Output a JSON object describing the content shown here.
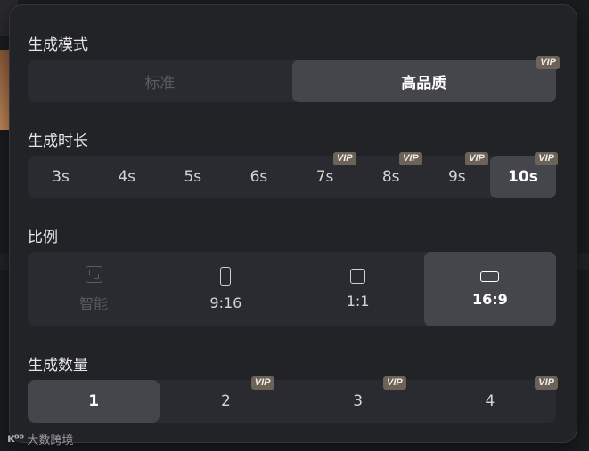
{
  "watermark": {
    "logo": "ᴋᵒᵒ",
    "text": "大数跨境"
  },
  "mode": {
    "title": "生成模式",
    "options": [
      {
        "label": "标准",
        "state": "disabled",
        "vip": ""
      },
      {
        "label": "高品质",
        "state": "active",
        "vip": "VIP"
      }
    ]
  },
  "duration": {
    "title": "生成时长",
    "options": [
      {
        "label": "3s",
        "vip": ""
      },
      {
        "label": "4s",
        "vip": ""
      },
      {
        "label": "5s",
        "vip": ""
      },
      {
        "label": "6s",
        "vip": ""
      },
      {
        "label": "7s",
        "vip": "VIP"
      },
      {
        "label": "8s",
        "vip": "VIP"
      },
      {
        "label": "9s",
        "vip": "VIP"
      },
      {
        "label": "10s",
        "vip": "VIP",
        "active": true
      }
    ]
  },
  "ratio": {
    "title": "比例",
    "options": [
      {
        "label": "智能",
        "icon": "smart-ratio-icon",
        "state": "disabled"
      },
      {
        "label": "9:16",
        "icon": "portrait-ratio-icon",
        "state": "normal"
      },
      {
        "label": "1:1",
        "icon": "square-ratio-icon",
        "state": "normal"
      },
      {
        "label": "16:9",
        "icon": "landscape-ratio-icon",
        "state": "active"
      }
    ]
  },
  "count": {
    "title": "生成数量",
    "options": [
      {
        "label": "1",
        "vip": "",
        "active": true
      },
      {
        "label": "2",
        "vip": "VIP"
      },
      {
        "label": "3",
        "vip": "VIP"
      },
      {
        "label": "4",
        "vip": "VIP"
      }
    ]
  },
  "colors": {
    "panel": "#222327",
    "segment_bg": "#2a2b30",
    "active_bg": "#45464c",
    "vip_badge": "#6b6358"
  }
}
